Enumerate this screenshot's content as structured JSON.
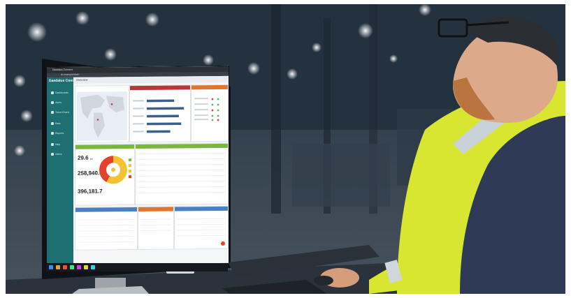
{
  "app": {
    "name": "Daedalus Connect"
  },
  "browser": {
    "tab_label": "Daedalus Connect",
    "url_text": "dc.example/dash"
  },
  "sidebar": {
    "brand": "Daedalus Connect",
    "items": [
      {
        "label": "Dashboards",
        "icon": "grid-icon"
      },
      {
        "label": "Alerts",
        "icon": "bell-icon"
      },
      {
        "label": "Trend Charts",
        "icon": "chart-icon"
      },
      {
        "label": "Data",
        "icon": "database-icon"
      },
      {
        "label": "Reports",
        "icon": "doc-icon"
      },
      {
        "label": "Help",
        "icon": "help-icon"
      },
      {
        "label": "Admin",
        "icon": "user-icon"
      }
    ]
  },
  "header": {
    "breadcrumb": "Overview"
  },
  "kpis": [
    {
      "value": "29.6",
      "unit": "psi"
    },
    {
      "value": "258,940.6",
      "unit": ""
    },
    {
      "value": "396,181.7",
      "unit": ""
    }
  ],
  "colors": {
    "sidebar": "#1d6f72",
    "panel_header_red": "#b5373a",
    "panel_header_orange": "#e0752f",
    "panel_header_green": "#78b83f",
    "panel_header_blue": "#4a7fc0",
    "donut_red": "#e2412b",
    "donut_yellow": "#f2c233",
    "jacket_yellow": "#d9e631"
  },
  "chart_data": {
    "type": "bar",
    "categories": [
      "",
      "",
      "",
      "",
      ""
    ],
    "values": [
      70,
      95,
      82,
      88,
      60
    ]
  }
}
